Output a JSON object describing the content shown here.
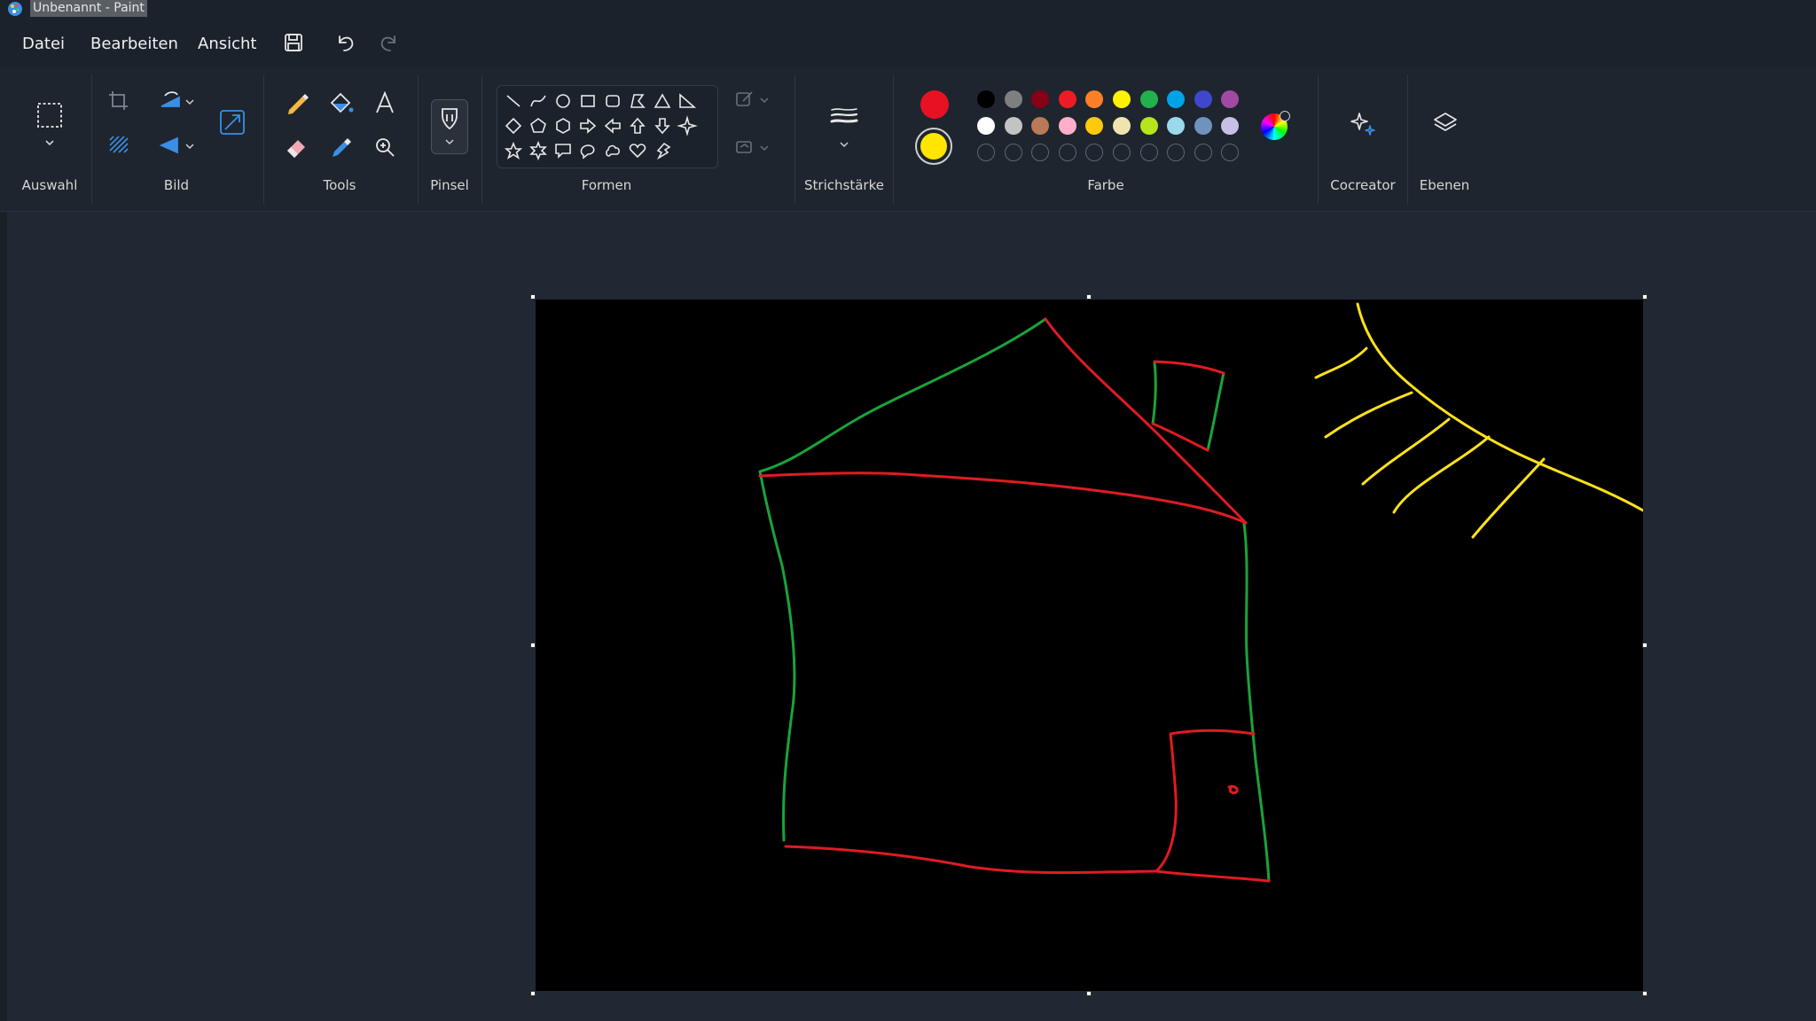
{
  "window": {
    "title": "Unbenannt - Paint",
    "app_icon": "paint-palette-icon"
  },
  "menu": [
    {
      "label": "Datei"
    },
    {
      "label": "Bearbeiten"
    },
    {
      "label": "Ansicht"
    }
  ],
  "quick_access": [
    {
      "icon": "save-icon"
    },
    {
      "icon": "undo-icon"
    },
    {
      "icon": "redo-icon",
      "enabled": false
    }
  ],
  "ribbon": {
    "groups": {
      "selection": "Auswahl",
      "image": "Bild",
      "tools": "Tools",
      "brush": "Pinsel",
      "shapes": "Formen",
      "stroke": "Strichstärke",
      "color": "Farbe",
      "cocreator": "Cocreator",
      "layers": "Ebenen"
    },
    "icons": {
      "selection": "rectangle-select-icon",
      "image": [
        "crop-icon",
        "rotate-icon",
        "resize-icon",
        "background-remove-icon",
        "flip-icon"
      ],
      "tools": [
        "pencil-icon",
        "fill-icon",
        "text-icon",
        "eraser-icon",
        "color-picker-icon",
        "magnifier-icon"
      ],
      "brush": "brush-icon",
      "stroke": "stroke-width-icon",
      "cocreator": "cocreator-sparkle-icon",
      "layers": "layers-icon"
    },
    "colors": {
      "primary": "#e81123",
      "secondary": "#ffe600",
      "palette_row1": [
        "#000000",
        "#7f7f7f",
        "#880015",
        "#ed1c24",
        "#ff7f27",
        "#fff200",
        "#22b14c",
        "#00a2e8",
        "#3f48cc",
        "#a349a4"
      ],
      "palette_row2": [
        "#ffffff",
        "#c3c3c3",
        "#b97a57",
        "#ffaec9",
        "#ffc90e",
        "#efe4b0",
        "#b5e61d",
        "#99d9ea",
        "#7092be",
        "#c8bfe7"
      ],
      "custom_slots": 10,
      "edit_colors_icon": "color-wheel-icon"
    }
  },
  "drawing": {
    "background": "#000000",
    "stroke_colors": {
      "green": "#1aa33a",
      "red": "#e01b22",
      "yellow": "#ffe21a"
    }
  }
}
